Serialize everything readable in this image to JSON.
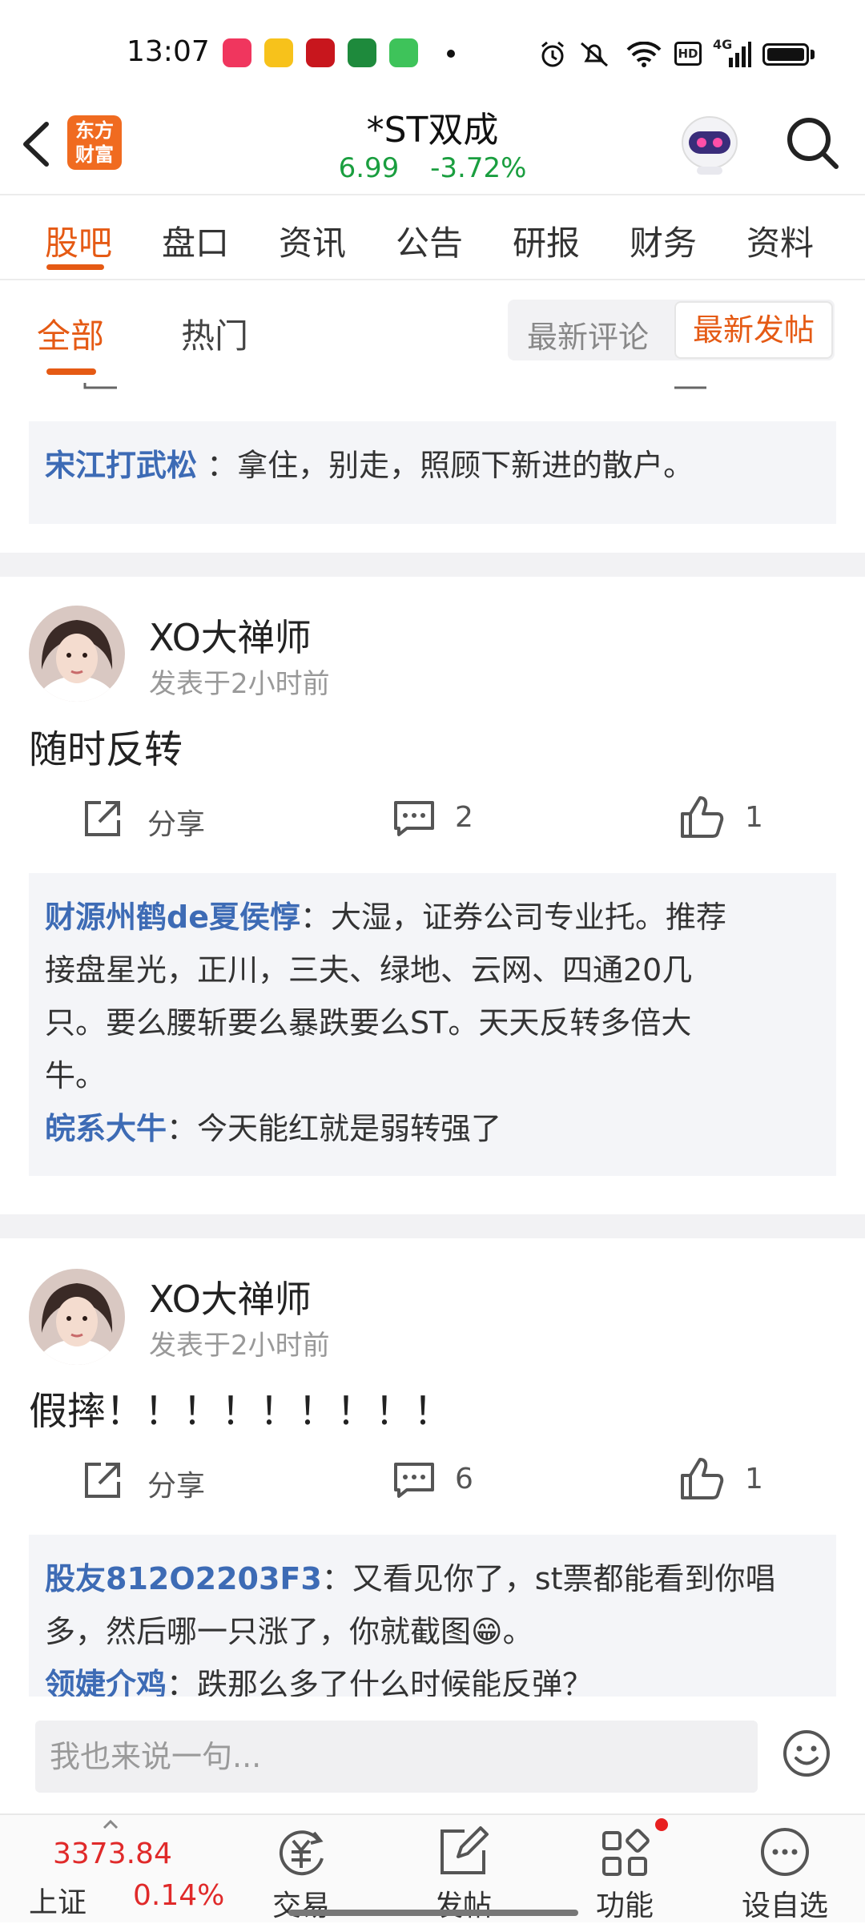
{
  "status_bar": {
    "time": "13:07",
    "icons": [
      "music-app-icon",
      "meituan-app-icon",
      "bank-app-icon",
      "oppo-app-icon",
      "shopping-app-icon",
      "alarm-icon",
      "mute-icon",
      "wifi-icon",
      "hd-icon",
      "signal-icon",
      "battery-icon"
    ],
    "hd": "HD",
    "network": "4G"
  },
  "header": {
    "logo_text": "东方财富",
    "logo_line1": "东方",
    "logo_line2": "财富",
    "stock_name": "*ST双成",
    "price": "6.99",
    "change": "-3.72%",
    "price_color": "#1a9e3f"
  },
  "main_tabs": [
    {
      "label": "股吧",
      "active": true
    },
    {
      "label": "盘口"
    },
    {
      "label": "资讯"
    },
    {
      "label": "公告"
    },
    {
      "label": "研报"
    },
    {
      "label": "财务"
    },
    {
      "label": "资料"
    }
  ],
  "sub_tabs": [
    {
      "label": "全部",
      "active": true
    },
    {
      "label": "热门"
    }
  ],
  "sort": {
    "latest_comment": "最新评论",
    "latest_post": "最新发帖"
  },
  "posts": [
    {
      "replies": [
        {
          "user": "宋江打武松",
          "text": "：拿住，别走，照顾下新进的散户。"
        }
      ]
    },
    {
      "username": "XO大禅师",
      "time": "发表于2小时前",
      "content": "随时反转",
      "share_label": "分享",
      "comments": "2",
      "likes": "1",
      "replies": [
        {
          "user": "财源州鹤de夏侯惇",
          "text_lines": [
            "：大湿，证券公司专业托。推荐",
            "接盘星光，正川，三夫、绿地、云网、四通20几",
            "只。要么腰斩要么暴跌要么ST。天天反转多倍大",
            "牛。"
          ]
        },
        {
          "user": "皖系大牛",
          "text": "：今天能红就是弱转强了"
        }
      ]
    },
    {
      "username": "XO大禅师",
      "time": "发表于2小时前",
      "content": "假摔！！！！！！！！！",
      "share_label": "分享",
      "comments": "6",
      "likes": "1",
      "replies": [
        {
          "user": "股友812O2203F3",
          "text_lines": [
            "：又看见你了，st票都能看到你唱",
            "多，然后哪一只涨了，你就截图😁。"
          ]
        },
        {
          "user": "领婕介鸡",
          "text": "：跌那么多了什么时候能反弹？"
        }
      ]
    }
  ],
  "comment_bar": {
    "placeholder": "我也来说一句..."
  },
  "bottom_nav": {
    "index_value": "3373.84",
    "index_name": "上证",
    "index_change": "0.14%",
    "items": [
      {
        "label": "交易",
        "icon": "trade-icon"
      },
      {
        "label": "发帖",
        "icon": "compose-icon"
      },
      {
        "label": "功能",
        "icon": "grid-icon"
      },
      {
        "label": "设自选",
        "icon": "more-icon"
      }
    ]
  },
  "colors": {
    "accent": "#e55a14",
    "up": "#e02a2a",
    "down": "#1a9e3f",
    "link": "#3d6bb5"
  }
}
